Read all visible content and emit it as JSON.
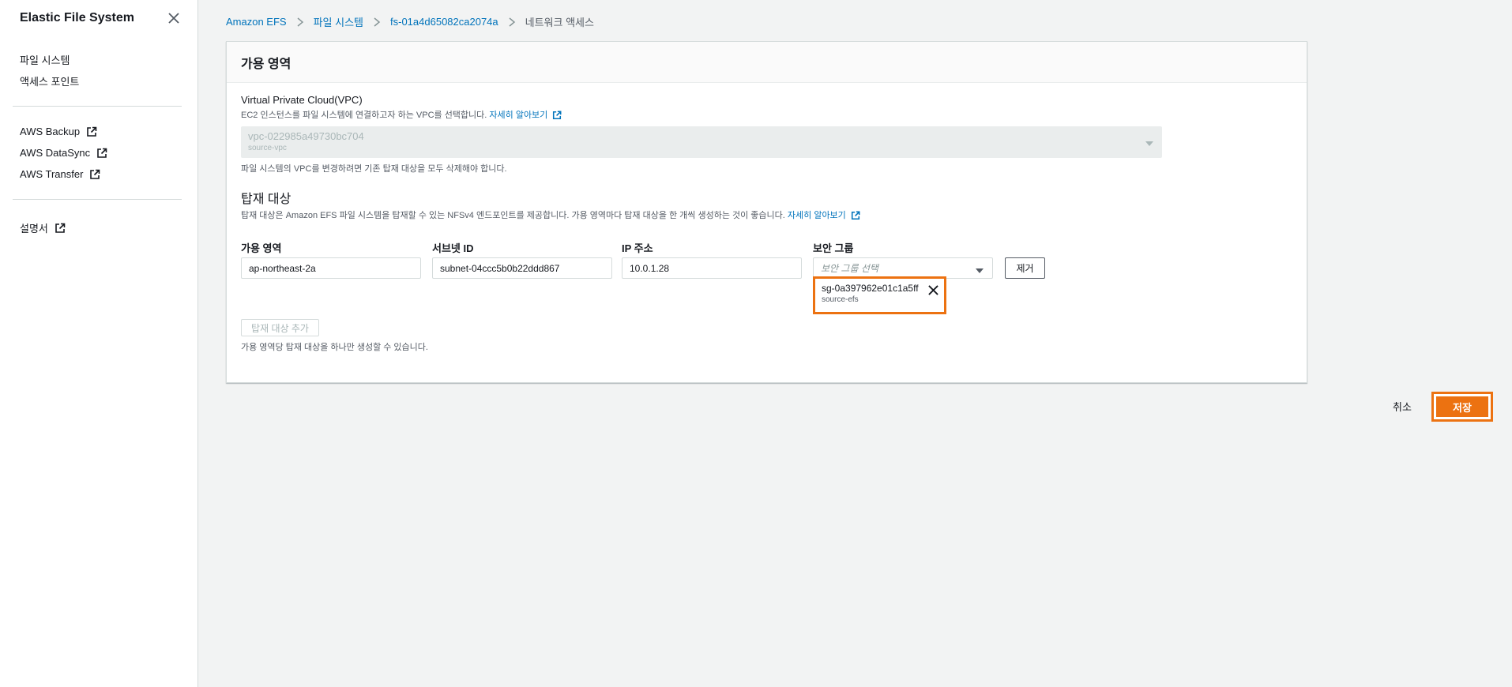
{
  "sidebar": {
    "title": "Elastic File System",
    "items": [
      {
        "label": "파일 시스템"
      },
      {
        "label": "액세스 포인트"
      }
    ],
    "external_items": [
      {
        "label": "AWS Backup"
      },
      {
        "label": "AWS DataSync"
      },
      {
        "label": "AWS Transfer"
      }
    ],
    "docs": {
      "label": "설명서"
    }
  },
  "breadcrumb": {
    "items": [
      "Amazon EFS",
      "파일 시스템",
      "fs-01a4d65082ca2074a"
    ],
    "current": "네트워크 액세스"
  },
  "panel": {
    "title": "가용 영역",
    "vpc": {
      "label": "Virtual Private Cloud(VPC)",
      "description": "EC2 인스턴스를 파일 시스템에 연결하고자 하는 VPC를 선택합니다.",
      "learn_more": "자세히 알아보기",
      "value": "vpc-022985a49730bc704",
      "sub_value": "source-vpc",
      "hint": "파일 시스템의 VPC를 변경하려면 기존 탑재 대상을 모두 삭제해야 합니다."
    },
    "mount_targets": {
      "title": "탑재 대상",
      "description": "탑재 대상은 Amazon EFS 파일 시스템을 탑재할 수 있는 NFSv4 엔드포인트를 제공합니다. 가용 영역마다 탑재 대상을 한 개씩 생성하는 것이 좋습니다.",
      "learn_more": "자세히 알아보기",
      "columns": {
        "az": "가용 영역",
        "subnet": "서브넷 ID",
        "ip": "IP 주소",
        "sg": "보안 그룹"
      },
      "row": {
        "az": "ap-northeast-2a",
        "subnet": "subnet-04ccc5b0b22ddd867",
        "ip": "10.0.1.28",
        "sg_placeholder": "보안 그룹 선택",
        "remove_label": "제거",
        "sg_token": {
          "id": "sg-0a397962e01c1a5ff",
          "name": "source-efs"
        }
      },
      "add_label": "탑재 대상 추가",
      "add_hint": "가용 영역당 탑재 대상을 하나만 생성할 수 있습니다."
    }
  },
  "footer": {
    "cancel": "취소",
    "save": "저장"
  },
  "colors": {
    "accent": "#ec7211",
    "link": "#0073bb"
  }
}
